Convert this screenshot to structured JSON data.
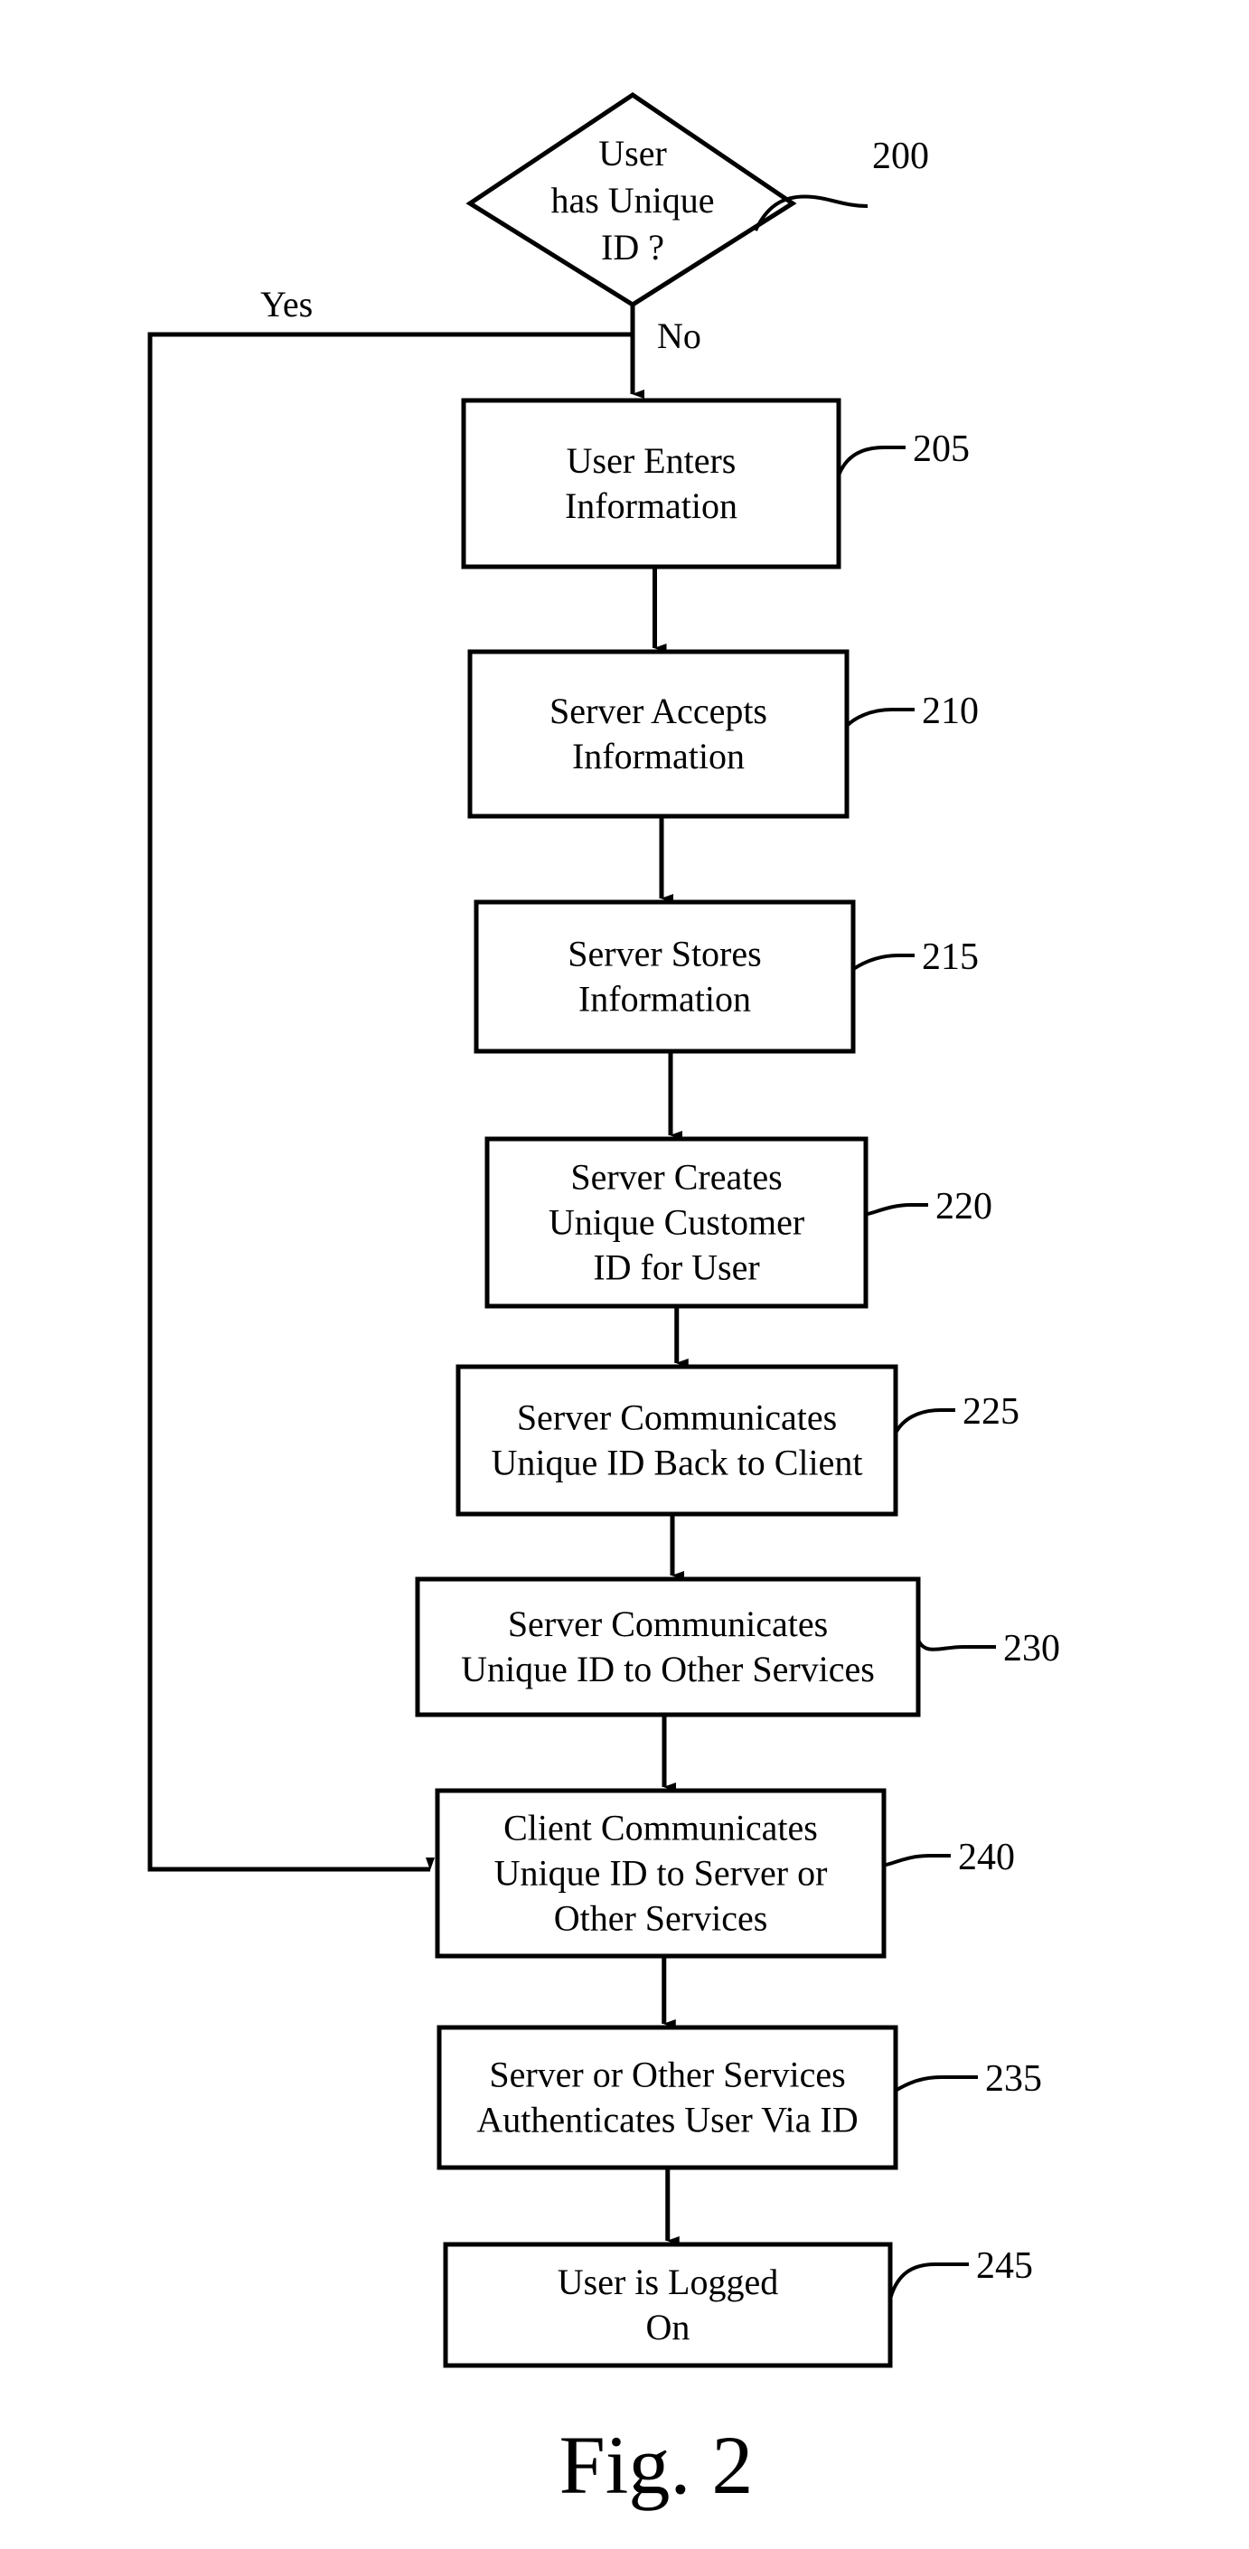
{
  "figure": {
    "caption": "Fig. 2",
    "decision": {
      "ref": "200",
      "lines": [
        "User",
        "has Unique",
        "ID ?"
      ],
      "yes_label": "Yes",
      "no_label": "No"
    },
    "steps": [
      {
        "ref": "205",
        "lines": [
          "User Enters",
          "Information"
        ]
      },
      {
        "ref": "210",
        "lines": [
          "Server Accepts",
          "Information"
        ]
      },
      {
        "ref": "215",
        "lines": [
          "Server Stores",
          "Information"
        ]
      },
      {
        "ref": "220",
        "lines": [
          "Server Creates",
          "Unique Customer",
          "ID for User"
        ]
      },
      {
        "ref": "225",
        "lines": [
          "Server Communicates",
          "Unique ID Back to Client"
        ]
      },
      {
        "ref": "230",
        "lines": [
          "Server Communicates",
          "Unique ID to Other Services"
        ]
      },
      {
        "ref": "240",
        "lines": [
          "Client Communicates",
          "Unique ID to Server or",
          "Other Services"
        ]
      },
      {
        "ref": "235",
        "lines": [
          "Server or Other Services",
          "Authenticates User Via ID"
        ]
      },
      {
        "ref": "245",
        "lines": [
          "User is Logged",
          "On"
        ]
      }
    ]
  }
}
